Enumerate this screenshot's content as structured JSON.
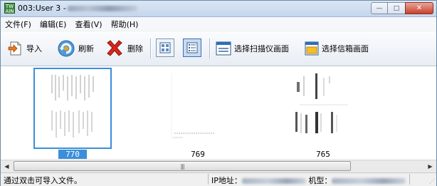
{
  "window": {
    "title_prefix": "003:User 3 -",
    "app_icon_text": "TWAIN",
    "buttons": {
      "minimize": "—",
      "maximize": "□",
      "close": "✕"
    }
  },
  "menu": [
    {
      "label": "文件(F)"
    },
    {
      "label": "编辑(E)"
    },
    {
      "label": "查看(V)"
    },
    {
      "label": "帮助(H)"
    }
  ],
  "toolbar": {
    "import_label": "导入",
    "refresh_label": "刷新",
    "delete_label": "删除",
    "select_scanner_label": "选择扫描仪画面",
    "select_mailbox_label": "选择信箱画面"
  },
  "thumbnails": [
    {
      "label": "770",
      "selected": true
    },
    {
      "label": "769",
      "selected": false
    },
    {
      "label": "765",
      "selected": false
    }
  ],
  "scrollbar": {
    "left_arrow": "◀",
    "right_arrow": "▶",
    "grip": "|||"
  },
  "status": {
    "hint": "通过双击可导入文件。",
    "ip_label": "IP地址：",
    "model_label": "机型："
  },
  "colors": {
    "selection": "#3b8ed9",
    "titlebar": "#c5d6ec",
    "close_button": "#c9412b"
  }
}
